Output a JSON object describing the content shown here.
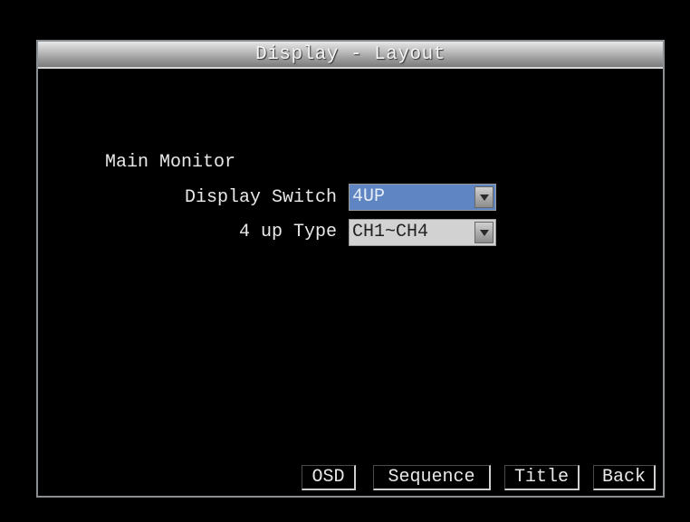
{
  "window": {
    "title": "Display - Layout"
  },
  "section": {
    "label": "Main Monitor"
  },
  "fields": {
    "display_switch": {
      "label": "Display Switch",
      "value": "4UP"
    },
    "four_up_type": {
      "label": "4 up Type",
      "value": "CH1~CH4"
    }
  },
  "buttons": {
    "osd": "OSD",
    "sequence": "Sequence",
    "title": "Title",
    "back": "Back"
  },
  "colors": {
    "background": "#000000",
    "selected_field": "#5f86c2",
    "field": "#d2d2d2",
    "text": "#e9e9e9"
  },
  "icons": {
    "dropdown": "chevron-down-icon"
  }
}
